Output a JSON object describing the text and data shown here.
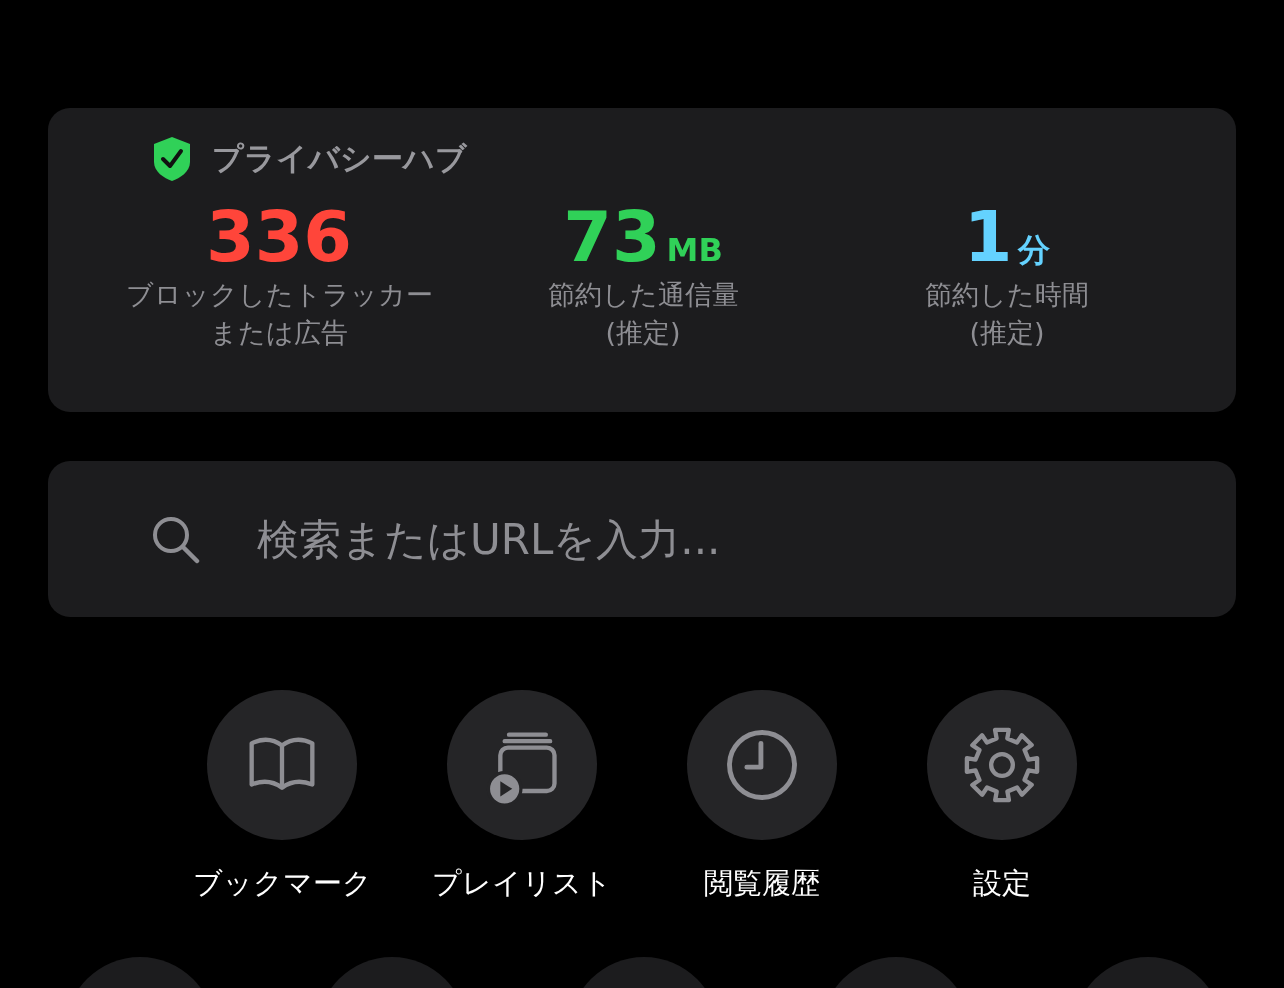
{
  "privacy_hub": {
    "title": "プライバシーハブ",
    "stats": [
      {
        "value": "336",
        "label_lines": [
          "ブロックしたトラッカー",
          "または広告"
        ],
        "color": "#ff453a"
      },
      {
        "value": "73",
        "unit": "MB",
        "label_lines": [
          "節約した通信量",
          "(推定)"
        ],
        "color": "#30d158"
      },
      {
        "value": "1",
        "unit": "分",
        "label_lines": [
          "節約した時間",
          "(推定)"
        ],
        "color": "#64d2ff"
      }
    ]
  },
  "search": {
    "placeholder": "検索またはURLを入力..."
  },
  "shortcuts": [
    {
      "kind": "bookmarks",
      "label": "ブックマーク"
    },
    {
      "kind": "playlist",
      "label": "プレイリスト"
    },
    {
      "kind": "history",
      "label": "閲覧履歴"
    },
    {
      "kind": "settings",
      "label": "設定"
    }
  ],
  "next_row": [
    {
      "kind": "shortcut"
    },
    {
      "kind": "shortcut"
    },
    {
      "kind": "shortcut"
    },
    {
      "kind": "shortcut"
    },
    {
      "kind": "shortcut"
    }
  ]
}
